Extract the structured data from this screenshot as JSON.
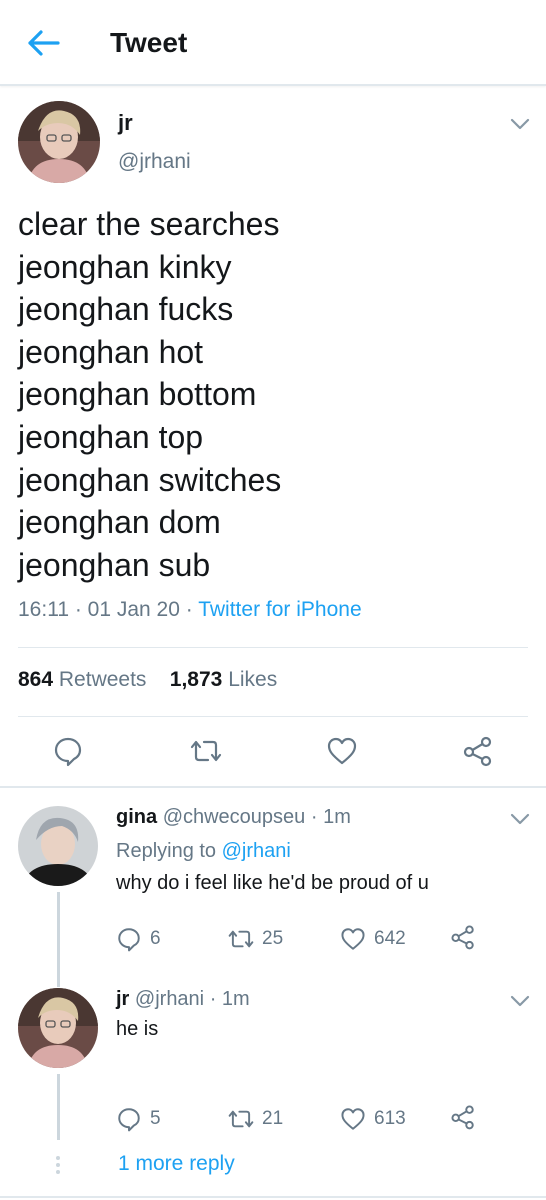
{
  "header": {
    "title": "Tweet",
    "back_icon": "arrow-left-icon",
    "accent": "#1da1f2"
  },
  "tweet": {
    "name": "jr",
    "handle": "@jrhani",
    "lines": [
      "clear the searches",
      "jeonghan kinky",
      "jeonghan fucks",
      "jeonghan hot",
      "jeonghan bottom",
      "jeonghan top",
      "jeonghan switches",
      "jeonghan dom",
      "jeonghan sub"
    ],
    "time": "16:11",
    "sep": " · ",
    "date": "01 Jan 20",
    "source": "Twitter for iPhone",
    "retweets_count": "864",
    "retweets_label": "Retweets",
    "likes_count": "1,873",
    "likes_label": "Likes",
    "actions": [
      "reply-icon",
      "retweet-icon",
      "like-icon",
      "share-icon"
    ]
  },
  "replies": [
    {
      "name": "gina",
      "handle": "@chwecoupseu",
      "time": "· 1m",
      "replying_prefix": "Replying to",
      "replying_handle": "@jrhani",
      "text": "why do i feel like he'd be proud of u",
      "reply_count": "6",
      "retweet_count": "25",
      "like_count": "642"
    },
    {
      "name": "jr",
      "handle": "@jrhani",
      "time": "· 1m",
      "text": "he is",
      "reply_count": "5",
      "retweet_count": "21",
      "like_count": "613"
    }
  ],
  "more_reply_label": "1 more reply",
  "colors": {
    "text": "#14171a",
    "muted": "#657786",
    "link": "#1da1f2",
    "border": "#e1e8ed"
  }
}
